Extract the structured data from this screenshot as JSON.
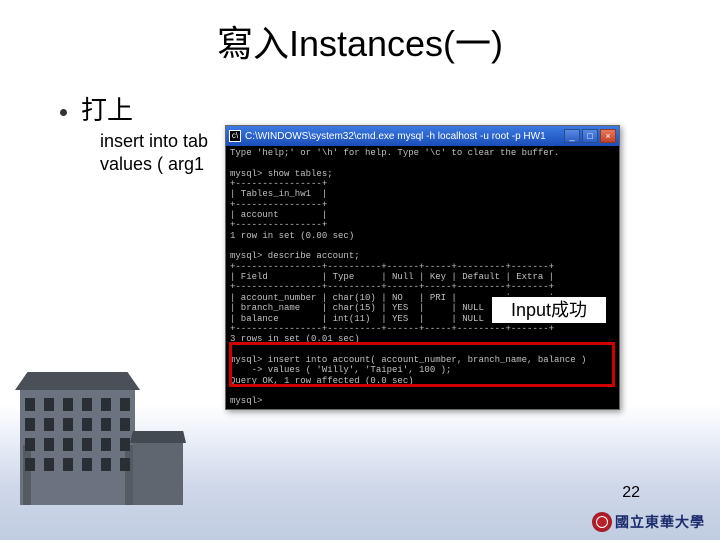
{
  "title": "寫入Instances(一)",
  "bullet": "打上",
  "code_line1": "insert into tab",
  "code_line2": "values ( arg1",
  "cmd": {
    "title": "C:\\WINDOWS\\system32\\cmd.exe  mysql  -h localhost -u root -p HW1",
    "min": "_",
    "max": "□",
    "close": "×",
    "body": "Type 'help;' or '\\h' for help. Type '\\c' to clear the buffer.\n\nmysql> show tables;\n+----------------+\n| Tables_in_hw1  |\n+----------------+\n| account        |\n+----------------+\n1 row in set (0.00 sec)\n\nmysql> describe account;\n+----------------+----------+------+-----+---------+-------+\n| Field          | Type     | Null | Key | Default | Extra |\n+----------------+----------+------+-----+---------+-------+\n| account_number | char(10) | NO   | PRI |         |       |\n| branch_name    | char(15) | YES  |     | NULL    |       |\n| balance        | int(11)  | YES  |     | NULL    |       |\n+----------------+----------+------+-----+---------+-------+\n3 rows in set (0.01 sec)\n\nmysql> insert into account( account_number, branch_name, balance )\n    -> values ( 'Willy', 'Taipei', 100 );\nQuery OK, 1 row affected (0.0 sec)\n\nmysql>"
  },
  "success_label": "Input成功",
  "page_number": "22",
  "university": "國立東華大學"
}
